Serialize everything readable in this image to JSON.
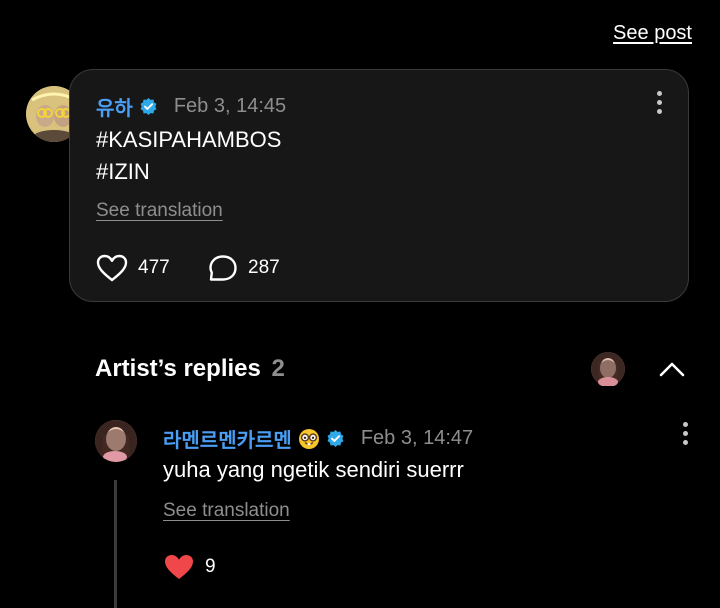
{
  "header": {
    "see_post": "See post"
  },
  "post": {
    "username": "유하",
    "timestamp": "Feb 3, 14:45",
    "lines": [
      "#KASIPAHAMBOS",
      "#IZIN"
    ],
    "see_translation": "See translation",
    "likes": "477",
    "comments": "287"
  },
  "replies_section": {
    "title": "Artist’s replies",
    "count": "2"
  },
  "reply": {
    "username": "라멘르멘카르멘",
    "emoji": "nerd-face-emoji",
    "timestamp": "Feb 3, 14:47",
    "text": "yuha yang ngetik sendiri suerrr",
    "see_translation": "See translation",
    "likes": "9"
  },
  "colors": {
    "background": "#000000",
    "card": "#171717",
    "username": "#4a9ff5",
    "verified": "#2fa8e8",
    "muted": "#8e8e8e",
    "heart_liked": "#f0474b"
  }
}
